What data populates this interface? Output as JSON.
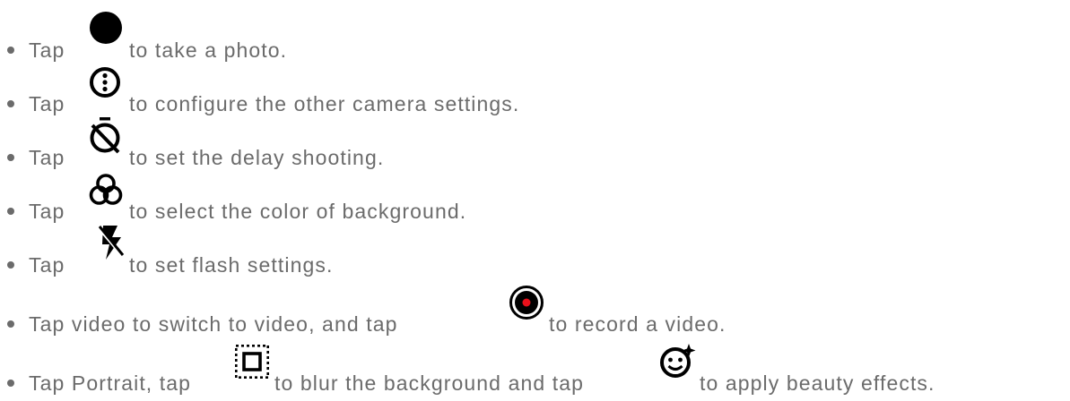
{
  "items": [
    {
      "prefix": "Tap",
      "icon": "shutter-icon",
      "suffix": "to take a photo."
    },
    {
      "prefix": "Tap",
      "icon": "more-options-icon",
      "suffix": "to configure the other camera settings."
    },
    {
      "prefix": "Tap",
      "icon": "timer-off-icon",
      "suffix": "to set the delay shooting."
    },
    {
      "prefix": "Tap",
      "icon": "color-filter-icon",
      "suffix": "to select the color of background."
    },
    {
      "prefix": "Tap",
      "icon": "flash-off-icon",
      "suffix": "to set flash settings."
    },
    {
      "prefix": "Tap video to switch to video, and tap",
      "icon": "record-icon",
      "suffix": "to record a video."
    },
    {
      "prefix": "Tap Portrait, tap",
      "icon": "blur-icon",
      "middle": "to blur the background and tap",
      "icon2": "beauty-face-icon",
      "suffix": "to apply beauty effects."
    }
  ],
  "colors": {
    "text": "#6b6b6b",
    "icon": "#000000",
    "record_dot": "#e8101a"
  }
}
